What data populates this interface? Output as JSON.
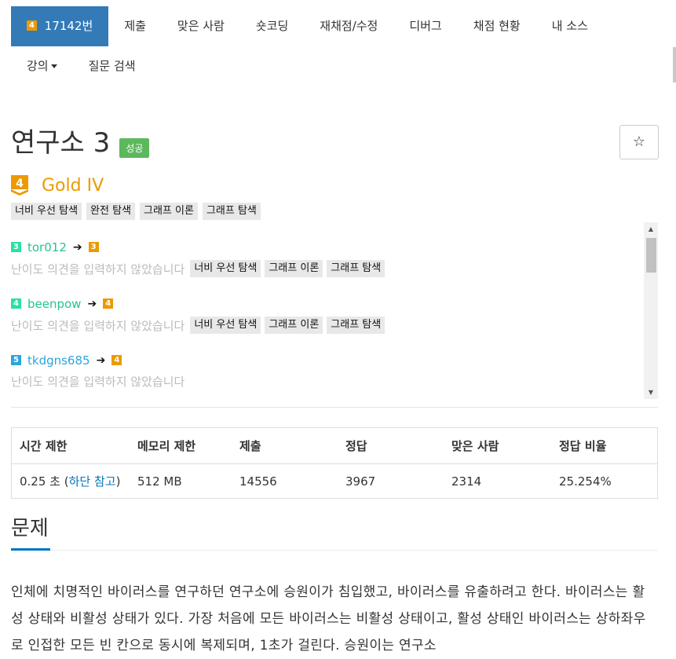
{
  "nav": {
    "problem_tier": "4",
    "problem_number": "17142번",
    "items": [
      "제출",
      "맞은 사람",
      "숏코딩",
      "재채점/수정",
      "디버그",
      "채점 현황",
      "내 소스"
    ],
    "row2": [
      "강의",
      "질문 검색"
    ]
  },
  "problem": {
    "title": "연구소 3",
    "status": "성공",
    "star": "☆",
    "tier_num": "4",
    "tier_name": "Gold IV",
    "tags": [
      "너비 우선 탐색",
      "완전 탐색",
      "그래프 이론",
      "그래프 탐색"
    ]
  },
  "opinions": [
    {
      "user_tier": "3",
      "user": "tor012",
      "arrow": "➔",
      "opinion_tier": "3",
      "note": "난이도 의견을 입력하지 않았습니다",
      "tags": [
        "너비 우선 탐색",
        "그래프 이론",
        "그래프 탐색"
      ]
    },
    {
      "user_tier": "4",
      "user": "beenpow",
      "arrow": "➔",
      "opinion_tier": "4",
      "note": "난이도 의견을 입력하지 않았습니다",
      "tags": [
        "너비 우선 탐색",
        "그래프 이론",
        "그래프 탐색"
      ]
    },
    {
      "user_tier": "5",
      "user": "tkdgns685",
      "arrow": "➔",
      "opinion_tier": "4",
      "note": "난이도 의견을 입력하지 않았습니다",
      "tags": []
    }
  ],
  "stats": {
    "headers": [
      "시간 제한",
      "메모리 제한",
      "제출",
      "정답",
      "맞은 사람",
      "정답 비율"
    ],
    "time_value": "0.25 초 (",
    "time_link": "하단 참고",
    "time_close": ")",
    "memory": "512 MB",
    "submissions": "14556",
    "accepted": "3967",
    "solvers": "2314",
    "ratio": "25.254%"
  },
  "section": {
    "title": "문제",
    "text": "인체에 치명적인 바이러스를 연구하던 연구소에 승원이가 침입했고, 바이러스를 유출하려고 한다. 바이러스는 활성 상태와 비활성 상태가 있다. 가장 처음에 모든 바이러스는 비활성 상태이고, 활성 상태인 바이러스는 상하좌우로 인접한 모든 빈 칸으로 동시에 복제되며, 1초가 걸린다. 승원이는 연구소"
  }
}
